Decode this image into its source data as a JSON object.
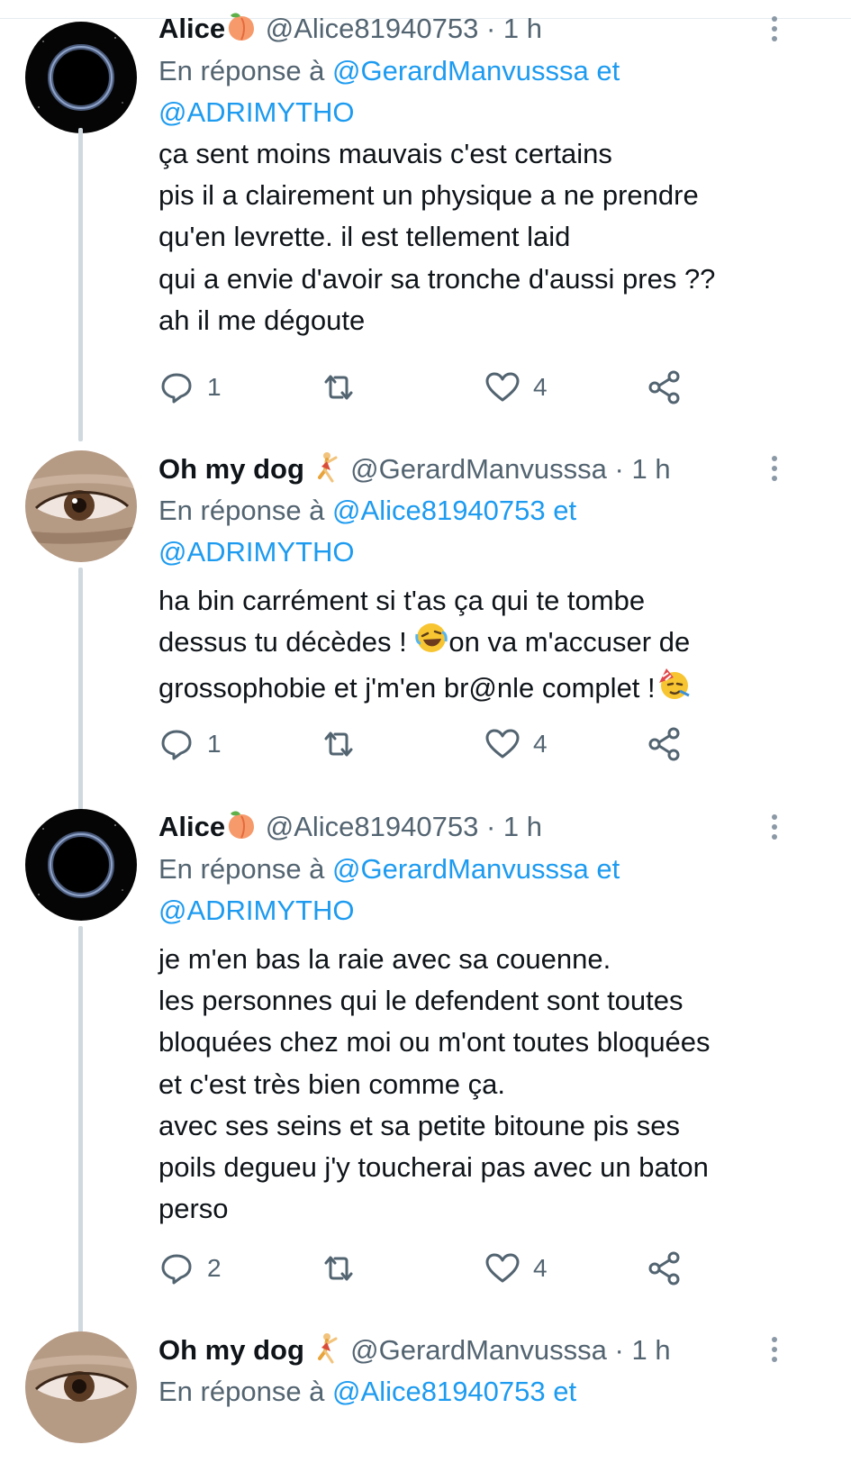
{
  "tweets": [
    {
      "name": "Alice",
      "name_emoji": "peach-emoji",
      "handle": "@Alice81940753",
      "separator": "·",
      "time": "1 h",
      "reply_prefix": "En réponse à",
      "reply_mention_1": "@GerardManvusssa",
      "reply_and": "et",
      "reply_mention_2": "@ADRIMYTHO",
      "lines": [
        "ça sent moins mauvais c'est certains",
        "pis il a clairement un physique a ne prendre",
        "qu'en levrette. il est tellement laid",
        "qui a envie d'avoir sa tronche d'aussi pres ??",
        "ah il me dégoute"
      ],
      "replies": "1",
      "likes": "4"
    },
    {
      "name": "Oh my dog",
      "name_emoji": "dancer-emoji",
      "handle": "@GerardManvusssa",
      "separator": "·",
      "time": "1 h",
      "reply_prefix": "En réponse à",
      "reply_mention_1": "@Alice81940753",
      "reply_and": "et",
      "reply_mention_2": "@ADRIMYTHO",
      "lines": [
        "ha bin carrément si t'as ça qui te tombe",
        "dessus tu décèdes !",
        "on va m'accuser de",
        "grossophobie et j'm'en br@nle complet !"
      ],
      "replies": "1",
      "likes": "4"
    },
    {
      "name": "Alice",
      "name_emoji": "peach-emoji",
      "handle": "@Alice81940753",
      "separator": "·",
      "time": "1 h",
      "reply_prefix": "En réponse à",
      "reply_mention_1": "@GerardManvusssa",
      "reply_and": "et",
      "reply_mention_2": "@ADRIMYTHO",
      "lines": [
        "je m'en bas la raie avec sa couenne.",
        "les personnes qui le defendent sont toutes",
        "bloquées chez moi ou m'ont toutes bloquées",
        "et c'est très bien comme ça.",
        "avec ses seins et sa petite bitoune pis ses",
        "poils degueu j'y toucherai pas avec un baton",
        "perso"
      ],
      "replies": "2",
      "likes": "4"
    },
    {
      "name": "Oh my dog",
      "name_emoji": "dancer-emoji",
      "handle": "@GerardManvusssa",
      "separator": "·",
      "time": "1 h",
      "reply_prefix": "En réponse à",
      "reply_mention_1": "@Alice81940753",
      "reply_and": "et"
    }
  ],
  "icons": {
    "reply": "reply-icon",
    "retweet": "retweet-icon",
    "like": "heart-icon",
    "share": "share-icon",
    "more": "more-vertical-icon",
    "laughing": "rolling-laughing-emoji",
    "party": "party-face-emoji"
  },
  "colors": {
    "link": "#1d9bf0",
    "secondary_text": "#536471",
    "primary_text": "#0f1419",
    "thread_line": "#cfd9de"
  }
}
